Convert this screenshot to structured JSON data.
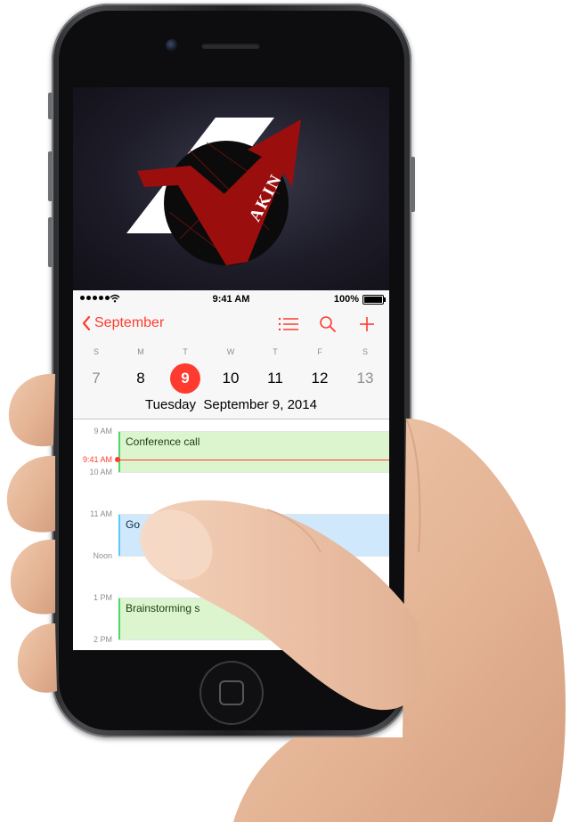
{
  "colors": {
    "accent": "#ff3b30",
    "event_green": "#dcf5cf",
    "event_blue": "#cfe8fb",
    "logo_red": "#9b0e0e"
  },
  "wallpaper": {
    "logo_text": "AKIN"
  },
  "status_bar": {
    "time": "9:41 AM",
    "battery": "100%"
  },
  "nav": {
    "back_label": "September",
    "icons": [
      "chevron-left-icon",
      "list-icon",
      "search-icon",
      "plus-icon"
    ]
  },
  "week": {
    "weekdays": [
      "S",
      "M",
      "T",
      "W",
      "T",
      "F",
      "S"
    ],
    "days": [
      "7",
      "8",
      "9",
      "10",
      "11",
      "12",
      "13"
    ],
    "selected_index": 2
  },
  "selected_date": {
    "weekday": "Tuesday",
    "date": "September 9, 2014"
  },
  "timeline": {
    "hours": [
      "9 AM",
      "10 AM",
      "11 AM",
      "Noon",
      "1 PM",
      "2 PM"
    ],
    "current_time": "9:41 AM",
    "events": [
      {
        "title": "Conference call",
        "color": "green"
      },
      {
        "title": "Go",
        "color": "blue"
      },
      {
        "title": "Brainstorming s",
        "color": "green"
      }
    ]
  }
}
